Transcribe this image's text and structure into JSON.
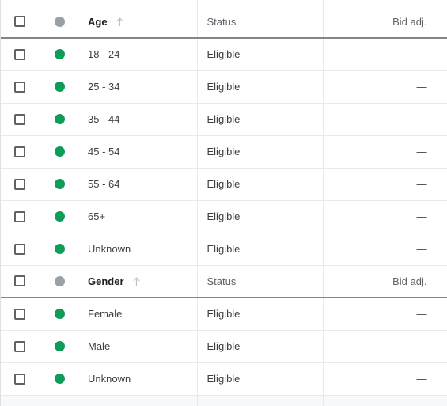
{
  "table": {
    "columns": {
      "name_header_age": "Age",
      "name_header_gender": "Gender",
      "status_header": "Status",
      "bid_header": "Bid adj."
    },
    "icons": {
      "checkbox": "checkbox-icon",
      "sort_ascending": "sort-ascending-arrow-icon",
      "status_dot_active": "status-dot-green-icon",
      "status_dot_header": "status-dot-gray-icon"
    },
    "colors": {
      "status_active": "#0d9d58",
      "status_header_dot": "#9aa0a6",
      "header_rule": "#80868b",
      "row_divider": "#e8eaed",
      "partial_row_background": "#f7f8f9",
      "text_primary": "#3c4043",
      "text_header": "#5f6368",
      "text_group_title": "#202124"
    },
    "groups": [
      {
        "id": "age",
        "title": "Age",
        "sorted": "ascending",
        "rows": [
          {
            "name": "18 - 24",
            "status": "Eligible",
            "bid_adj": "—"
          },
          {
            "name": "25 - 34",
            "status": "Eligible",
            "bid_adj": "—"
          },
          {
            "name": "35 - 44",
            "status": "Eligible",
            "bid_adj": "—"
          },
          {
            "name": "45 - 54",
            "status": "Eligible",
            "bid_adj": "—"
          },
          {
            "name": "55 - 64",
            "status": "Eligible",
            "bid_adj": "—"
          },
          {
            "name": "65+",
            "status": "Eligible",
            "bid_adj": "—"
          },
          {
            "name": "Unknown",
            "status": "Eligible",
            "bid_adj": "—"
          }
        ]
      },
      {
        "id": "gender",
        "title": "Gender",
        "sorted": "ascending",
        "rows": [
          {
            "name": "Female",
            "status": "Eligible",
            "bid_adj": "—"
          },
          {
            "name": "Male",
            "status": "Eligible",
            "bid_adj": "—"
          },
          {
            "name": "Unknown",
            "status": "Eligible",
            "bid_adj": "—"
          }
        ]
      }
    ]
  }
}
